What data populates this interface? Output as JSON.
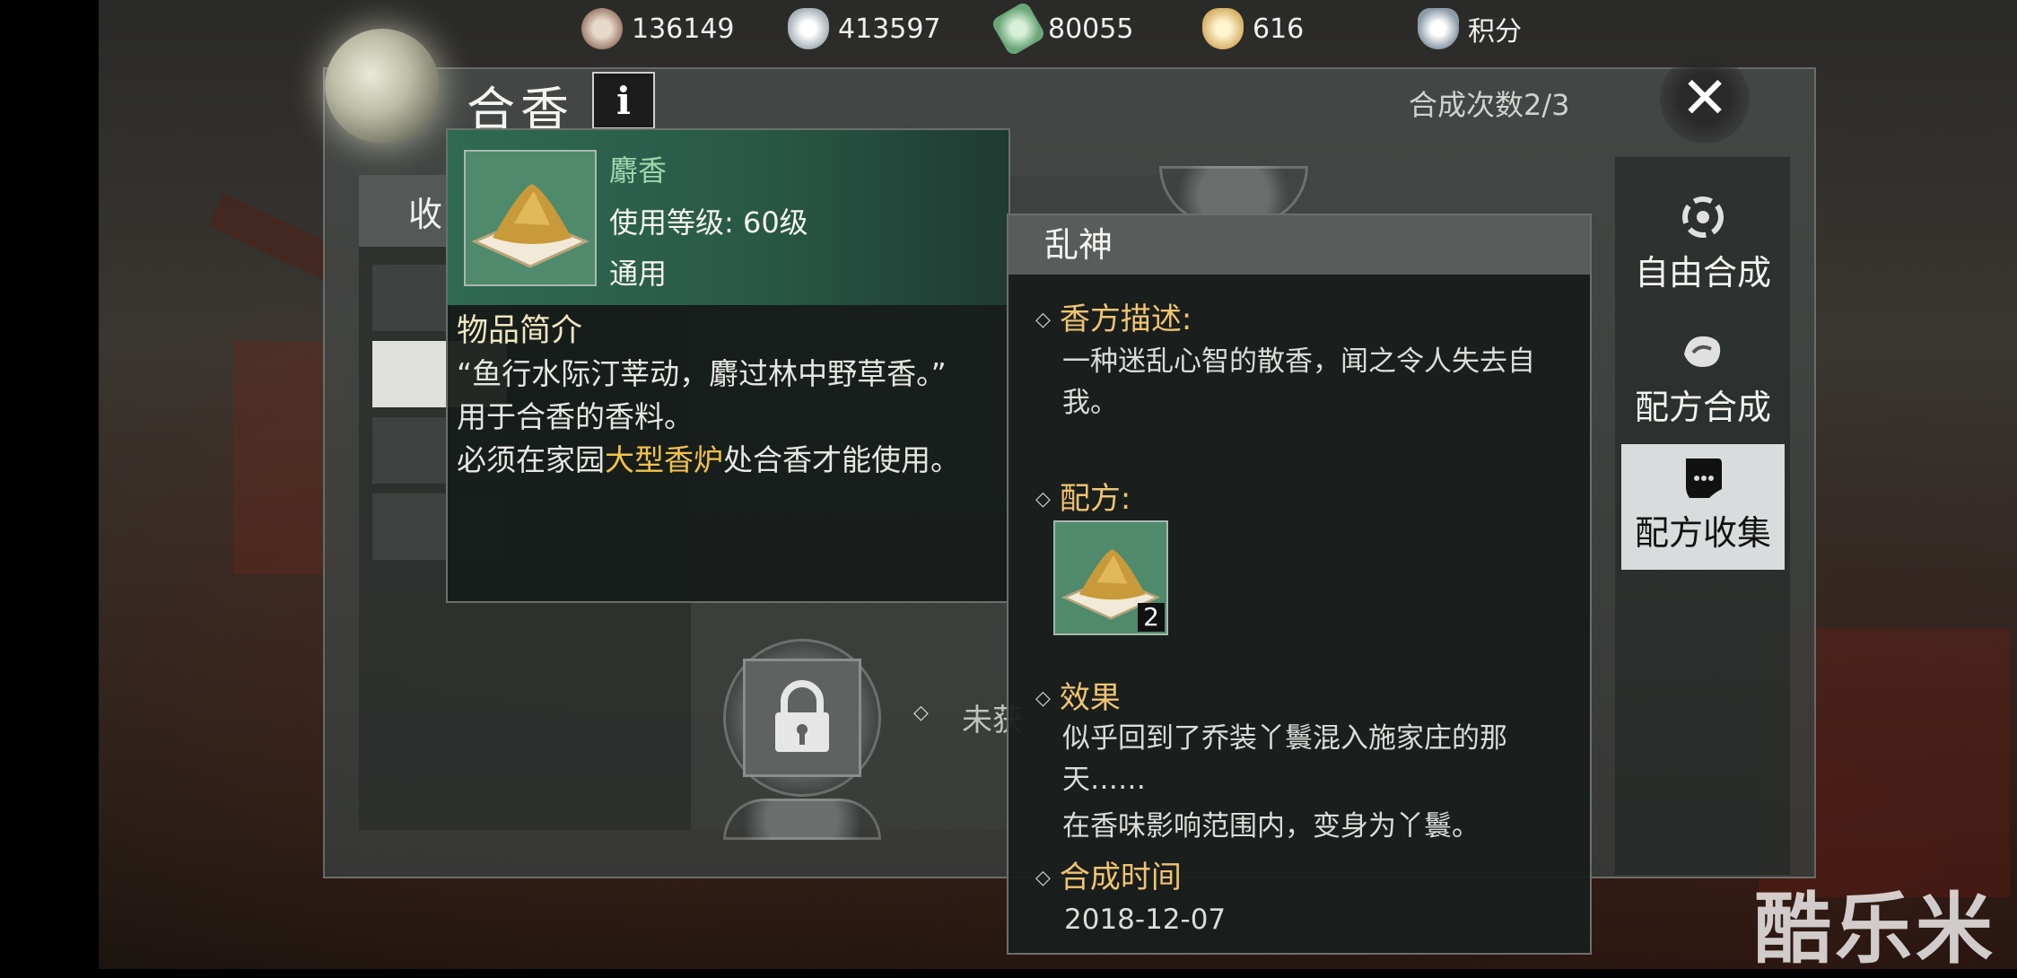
{
  "currencies": [
    {
      "icon": "copper-coin-add-icon",
      "value": "136149"
    },
    {
      "icon": "silver-ingot-add-icon",
      "value": "413597"
    },
    {
      "icon": "jade-add-icon",
      "value": "80055"
    },
    {
      "icon": "gold-ingot-add-icon",
      "value": "616"
    },
    {
      "icon": "score-shield-icon",
      "value": "积分"
    }
  ],
  "header": {
    "title": "合香",
    "info_label": "i",
    "craft_count": "合成次数2/3",
    "close_label": "✕"
  },
  "list": {
    "tab_label": "收"
  },
  "grid": {
    "locked_label": "未获"
  },
  "item_tooltip": {
    "name": "麝香",
    "level": "使用等级: 60级",
    "type": "通用",
    "section_title": "物品简介",
    "quote": "“鱼行水际汀莘动，麝过林中野草香。”",
    "usage": "用于合香的香料。",
    "requirement_prefix": "必须在家园",
    "requirement_highlight": "大型香炉",
    "requirement_suffix": "处合香才能使用。"
  },
  "recipe_tooltip": {
    "name": "乱神",
    "desc_title": "香方描述:",
    "desc_text": "一种迷乱心智的散香，闻之令人失去自我。",
    "recipe_title": "配方:",
    "recipe_qty": "2",
    "effect_title": "效果",
    "effect_line1": "似乎回到了乔装丫鬟混入施家庄的那天……",
    "effect_line2": "在香味影响范围内，变身为丫鬟。",
    "time_title": "合成时间",
    "time_value": "2018-12-07"
  },
  "side_tabs": [
    {
      "label": "自由合成",
      "icon": "free-craft-icon"
    },
    {
      "label": "配方合成",
      "icon": "recipe-craft-icon"
    },
    {
      "label": "配方收集",
      "icon": "recipe-scroll-icon",
      "active": true
    }
  ],
  "watermark": "酷乐米"
}
